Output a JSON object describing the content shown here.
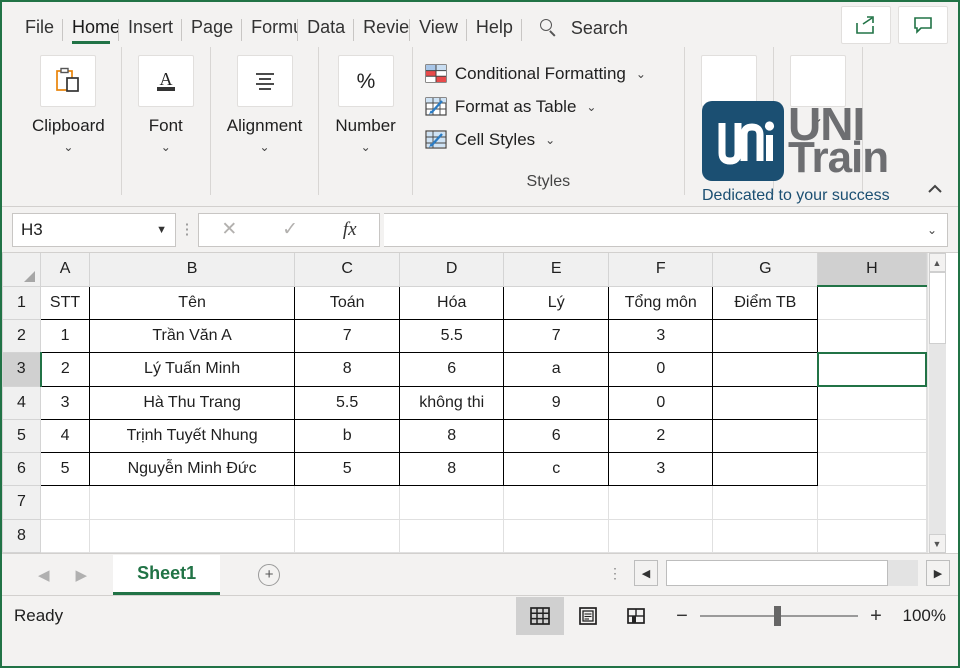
{
  "ribbon": {
    "tabs": [
      {
        "label": "File",
        "active": false
      },
      {
        "label": "Home",
        "active": true
      },
      {
        "label": "Insert",
        "active": false
      },
      {
        "label": "Page",
        "active": false
      },
      {
        "label": "Formu",
        "active": false
      },
      {
        "label": "Data",
        "active": false
      },
      {
        "label": "Review",
        "active": false
      },
      {
        "label": "View",
        "active": false
      },
      {
        "label": "Help",
        "active": false
      }
    ],
    "search_label": "Search",
    "search_icon": "search-icon",
    "share_icon": "share-icon",
    "comment_icon": "comment-icon",
    "collapse_icon": "chevron-up-icon",
    "groups": [
      {
        "label": "Clipboard",
        "icon": "clipboard-paste-icon"
      },
      {
        "label": "Font",
        "icon": "font-a-icon"
      },
      {
        "label": "Alignment",
        "icon": "alignment-lines-icon"
      },
      {
        "label": "Number",
        "icon": "percent-icon"
      }
    ],
    "styles": {
      "caption": "Styles",
      "items": [
        {
          "label": "Conditional Formatting",
          "icon": "conditional-formatting-icon",
          "chevron": "⌄"
        },
        {
          "label": "Format as Table",
          "icon": "format-as-table-icon",
          "chevron": "⌄"
        },
        {
          "label": "Cell Styles",
          "icon": "cell-styles-icon",
          "chevron": "⌄"
        }
      ]
    },
    "group_chevron": "⌄"
  },
  "logo": {
    "mark_text": "uni",
    "word_top": "UNI",
    "word_bottom": "Train",
    "tagline": "Dedicated to your success",
    "mark_color": "#1b4f72",
    "word_color": "#6d6e71",
    "tagline_color": "#1b4f72"
  },
  "formula_bar": {
    "name_box_value": "H3",
    "name_box_caret": "▼",
    "cancel_icon": "close-icon",
    "confirm_icon": "check-icon",
    "function_icon": "fx-icon",
    "formula_value": "",
    "expand_caret": "⌄"
  },
  "sheet": {
    "columns": [
      "A",
      "B",
      "C",
      "D",
      "E",
      "F",
      "G",
      "H"
    ],
    "selected_column": "H",
    "selected_row": 3,
    "selected_cell": "H3",
    "rows": [
      {
        "num": "1",
        "cells": [
          "STT",
          "Tên",
          "Toán",
          "Hóa",
          "Lý",
          "Tổng môn",
          "Điểm TB",
          ""
        ]
      },
      {
        "num": "2",
        "cells": [
          "1",
          "Trần Văn A",
          "7",
          "5.5",
          "7",
          "3",
          "",
          ""
        ]
      },
      {
        "num": "3",
        "cells": [
          "2",
          "Lý Tuấn Minh",
          "8",
          "6",
          "a",
          "0",
          "",
          ""
        ]
      },
      {
        "num": "4",
        "cells": [
          "3",
          "Hà Thu Trang",
          "5.5",
          "không thi",
          "9",
          "0",
          "",
          ""
        ]
      },
      {
        "num": "5",
        "cells": [
          "4",
          "Trịnh Tuyết Nhung",
          "b",
          "8",
          "6",
          "2",
          "",
          ""
        ]
      },
      {
        "num": "6",
        "cells": [
          "5",
          "Nguyễn Minh Đức",
          "5",
          "8",
          "c",
          "3",
          "",
          ""
        ]
      },
      {
        "num": "7",
        "cells": [
          "",
          "",
          "",
          "",
          "",
          "",
          "",
          ""
        ]
      },
      {
        "num": "8",
        "cells": [
          "",
          "",
          "",
          "",
          "",
          "",
          "",
          ""
        ]
      }
    ],
    "scroll_up_icon": "triangle-up-icon",
    "scroll_down_icon": "triangle-down-icon"
  },
  "sheet_tabs": {
    "prev_icon": "◀",
    "next_icon": "▶",
    "tabs": [
      {
        "label": "Sheet1",
        "active": true
      }
    ],
    "add_label": "+",
    "scroll_left_icon": "◀",
    "scroll_right_icon": "▶"
  },
  "status_bar": {
    "status": "Ready",
    "views": [
      {
        "name": "normal-view",
        "icon": "grid-icon",
        "active": true
      },
      {
        "name": "page-layout-view",
        "icon": "page-layout-icon",
        "active": false
      },
      {
        "name": "page-break-view",
        "icon": "page-break-icon",
        "active": false
      }
    ],
    "zoom_out": "−",
    "zoom_in": "+",
    "zoom_level": "100%"
  }
}
